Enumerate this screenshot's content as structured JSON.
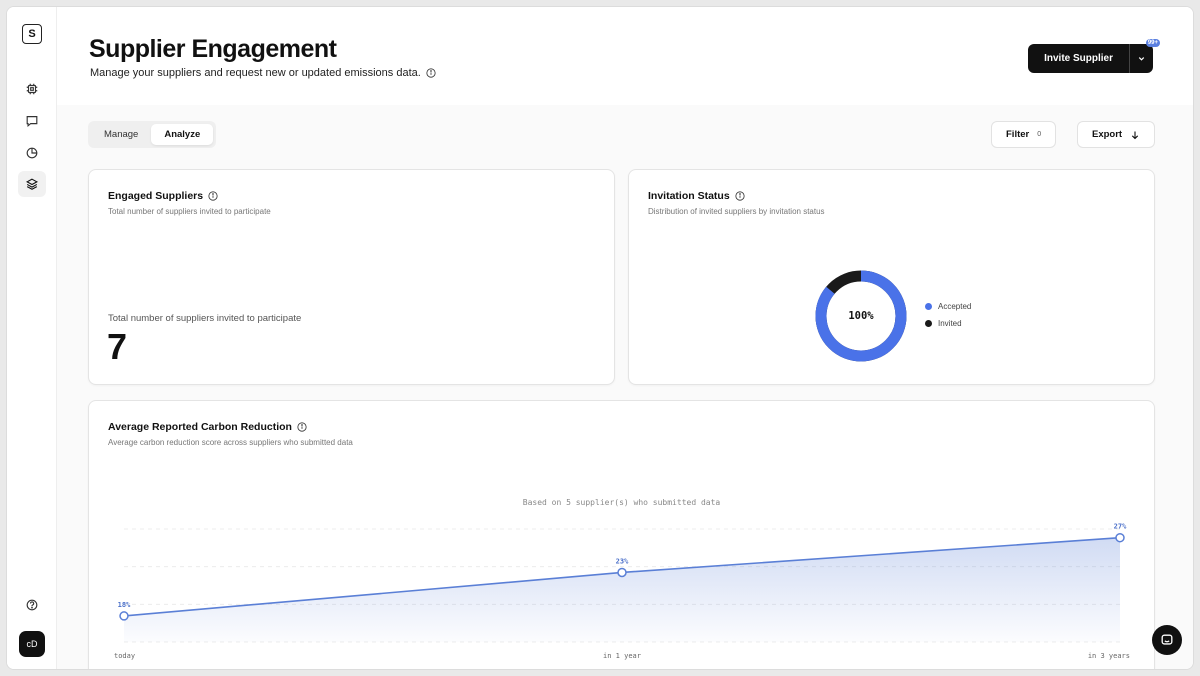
{
  "sidebar": {
    "logo_letter": "S",
    "items": [
      {
        "name": "chip-icon"
      },
      {
        "name": "message-icon"
      },
      {
        "name": "pie-chart-icon"
      },
      {
        "name": "layers-icon",
        "active": true
      }
    ],
    "help_icon": "help-circle-icon",
    "avatar_initials": "cD"
  },
  "header": {
    "title": "Supplier Engagement",
    "subtitle": "Manage your suppliers and request new or updated emissions data.",
    "invite_label": "Invite Supplier",
    "badge": "99+"
  },
  "toolbar": {
    "tabs": [
      {
        "label": "Manage",
        "active": false
      },
      {
        "label": "Analyze",
        "active": true
      }
    ],
    "filter_label": "Filter",
    "filter_count": "0",
    "export_label": "Export"
  },
  "engaged": {
    "title": "Engaged Suppliers",
    "subtitle": "Total number of suppliers invited to participate",
    "stat_label": "Total number of suppliers invited to participate",
    "stat_value": "7"
  },
  "invitation": {
    "title": "Invitation Status",
    "subtitle": "Distribution of invited suppliers by invitation status",
    "center_label": "100%",
    "legend": [
      {
        "label": "Accepted",
        "color": "#4a72e8"
      },
      {
        "label": "Invited",
        "color": "#1a1a1a"
      }
    ],
    "accepted_fraction": 0.86
  },
  "carbon": {
    "title": "Average Reported Carbon Reduction",
    "subtitle": "Average carbon reduction score across suppliers who submitted data",
    "note": "Based on 5 supplier(s) who submitted data"
  },
  "chart_data": {
    "type": "area",
    "categories": [
      "today",
      "in 1 year",
      "in 3 years"
    ],
    "values": [
      18,
      23,
      27
    ],
    "data_labels": [
      "18%",
      "23%",
      "27%"
    ],
    "ylim": [
      15,
      28
    ],
    "grid": true,
    "color": "#5a7fd6"
  }
}
